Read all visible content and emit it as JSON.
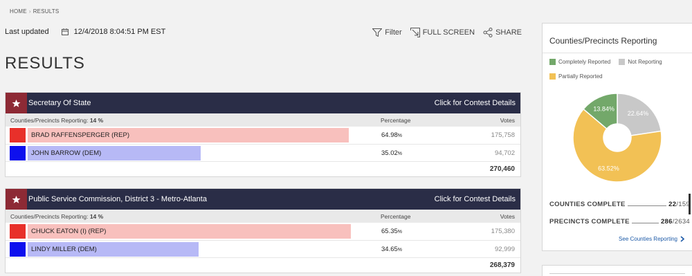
{
  "breadcrumb": {
    "home": "HOME",
    "results": "RESULTS"
  },
  "updated": {
    "label": "Last updated",
    "timestamp": "12/4/2018 8:04:51 PM EST"
  },
  "actions": {
    "filter": "Filter",
    "fullscreen": "FULL SCREEN",
    "share": "SHARE"
  },
  "page_title": "RESULTS",
  "colors": {
    "header_bg": "#2a2d47",
    "star_bg": "#8d2a35",
    "rep": "#e8302a",
    "rep_bar": "#f8c0bd",
    "dem": "#0e10ee",
    "dem_bar": "#b7b9f6",
    "completely": "#73a86a",
    "not_reporting": "#c8c8c8",
    "partially": "#f2c155"
  },
  "contests": [
    {
      "title": "Secretary Of State",
      "details_link": "Click for Contest Details",
      "reporting_label": "Counties/Precincts Reporting:",
      "reporting_value": "14 %",
      "percentage_header": "Percentage",
      "votes_header": "Votes",
      "candidates": [
        {
          "name": "BRAD RAFFENSPERGER (REP)",
          "party": "rep",
          "percent": "64.98",
          "percent_sign": "%",
          "votes": "175,758",
          "share": 0.6498
        },
        {
          "name": "JOHN BARROW (DEM)",
          "party": "dem",
          "percent": "35.02",
          "percent_sign": "%",
          "votes": "94,702",
          "share": 0.3502
        }
      ],
      "total": "270,460"
    },
    {
      "title": "Public Service Commission, District 3 - Metro-Atlanta",
      "details_link": "Click for Contest Details",
      "reporting_label": "Counties/Precincts Reporting:",
      "reporting_value": "14 %",
      "percentage_header": "Percentage",
      "votes_header": "Votes",
      "candidates": [
        {
          "name": "CHUCK EATON (I) (REP)",
          "party": "rep",
          "percent": "65.35",
          "percent_sign": "%",
          "votes": "175,380",
          "share": 0.6535
        },
        {
          "name": "LINDY MILLER (DEM)",
          "party": "dem",
          "percent": "34.65",
          "percent_sign": "%",
          "votes": "92,999",
          "share": 0.3465
        }
      ],
      "total": "268,379"
    }
  ],
  "sidebar": {
    "title": "Counties/Precincts Reporting",
    "legend": {
      "completely": "Completely Reported",
      "not_reporting": "Not Reporting",
      "partially": "Partially Reported"
    },
    "pie": {
      "completely_pct": 13.84,
      "not_reporting_pct": 22.64,
      "partially_pct": 63.52,
      "completely_label": "13.84%",
      "not_reporting_label": "22.64%",
      "partially_label": "63.52%"
    },
    "counties_label": "COUNTIES COMPLETE",
    "counties_num": "22",
    "counties_den": "/159",
    "precincts_label": "PRECINCTS COMPLETE",
    "precincts_num": "286",
    "precincts_den": "/2634",
    "see_link": "See Counties Reporting"
  }
}
